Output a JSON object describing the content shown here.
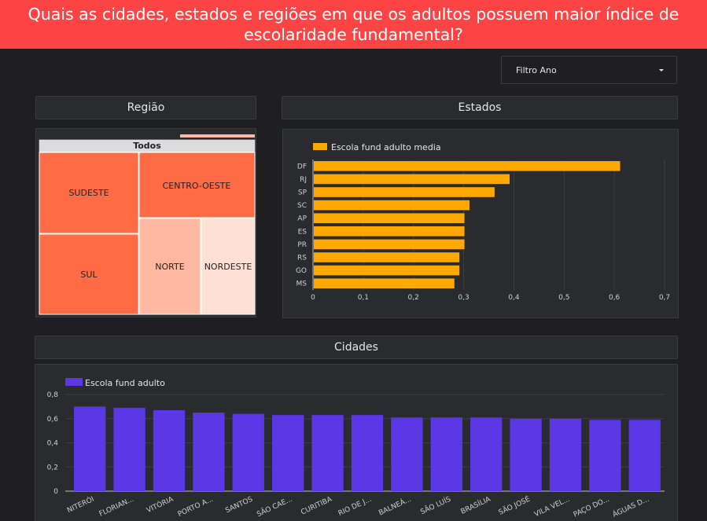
{
  "header": {
    "title": "Quais as cidades, estados e regiões em que os adultos possuem maior índice de escolaridade fundamental?"
  },
  "filter": {
    "label": "Filtro Ano"
  },
  "sections": {
    "regiao": "Região",
    "estados": "Estados",
    "cidades": "Cidades"
  },
  "colors": {
    "header": "#fd4445",
    "states_bar": "#ffa800",
    "cities_bar": "#5b37e5",
    "treemap_dark": "#ff6b45",
    "treemap_mid": "#ffb8a1",
    "treemap_light": "#ffe0d4"
  },
  "chart_data": [
    {
      "type": "treemap",
      "root": "Todos",
      "regions": [
        "SUDESTE",
        "SUL",
        "CENTRO-OESTE",
        "NORTE",
        "NORDESTE"
      ]
    },
    {
      "type": "bar",
      "orientation": "horizontal",
      "categories": [
        "DF",
        "RJ",
        "SP",
        "SC",
        "AP",
        "ES",
        "PR",
        "RS",
        "GO",
        "MS"
      ],
      "series": [
        {
          "name": "Escola fund adulto media",
          "values": [
            0.61,
            0.39,
            0.36,
            0.31,
            0.3,
            0.3,
            0.3,
            0.29,
            0.29,
            0.28
          ]
        }
      ],
      "xlim": [
        0,
        0.7
      ],
      "xticks": [
        "0",
        "0,1",
        "0,2",
        "0,3",
        "0,4",
        "0,5",
        "0,6",
        "0,7"
      ]
    },
    {
      "type": "bar",
      "categories": [
        "NITERÓI",
        "FLORIAN...",
        "VITÓRIA",
        "PORTO A...",
        "SANTOS",
        "SÃO CAE...",
        "CURITIBA",
        "RIO DE J...",
        "BALNEÁ...",
        "SÃO LUÍS",
        "BRASÍLIA",
        "SÃO JOSÉ",
        "VILA VEL...",
        "PAÇO DO...",
        "ÁGUAS D..."
      ],
      "series": [
        {
          "name": "Escola fund adulto",
          "values": [
            0.7,
            0.69,
            0.67,
            0.65,
            0.64,
            0.63,
            0.63,
            0.63,
            0.61,
            0.61,
            0.61,
            0.6,
            0.6,
            0.59,
            0.59
          ]
        }
      ],
      "ylim": [
        0,
        0.8
      ],
      "yticks": [
        "0",
        "0,2",
        "0,4",
        "0,6",
        "0,8"
      ]
    }
  ]
}
